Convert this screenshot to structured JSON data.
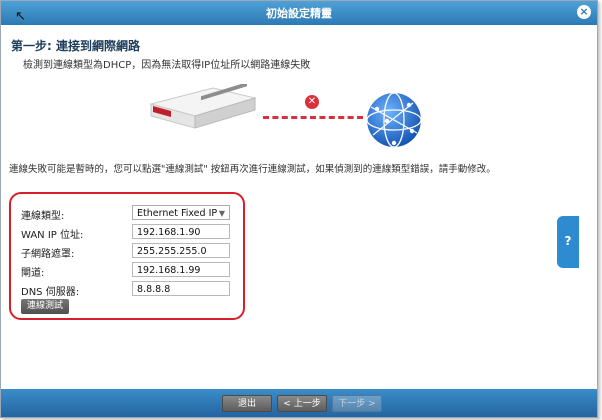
{
  "window": {
    "title": "初始設定精靈"
  },
  "step": {
    "title": "第一步: 連接到網際網路"
  },
  "status": {
    "message": "檢測到連線類型為DHCP，因為無法取得IP位址所以網路連線失敗"
  },
  "hint": {
    "message": "連線失敗可能是暫時的，您可以點選\"連線測試\" 按鈕再次進行連線測試，如果偵測到的連線類型錯誤，請手動修改。"
  },
  "form": {
    "connection_type_label": "連線類型:",
    "connection_type_value": "Ethernet Fixed IP",
    "wan_ip_label": "WAN IP 位址:",
    "wan_ip_value": "192.168.1.90",
    "subnet_label": "子網路遮罩:",
    "subnet_value": "255.255.255.0",
    "gateway_label": "閘道:",
    "gateway_value": "192.168.1.99",
    "dns_label": "DNS 伺服器:",
    "dns_value": "8.8.8.8",
    "retry_label": "連線測試"
  },
  "help": {
    "label": "?"
  },
  "footer": {
    "exit_label": "退出",
    "prev_label": "< 上一步",
    "next_label": "下一步 >"
  },
  "icons": {
    "close": "close-icon",
    "error": "error-icon",
    "device": "firewall-device-icon",
    "globe": "globe-icon"
  },
  "colors": {
    "accent": "#2e8bd0",
    "error": "#d9303a",
    "highlight": "#d81e28"
  }
}
